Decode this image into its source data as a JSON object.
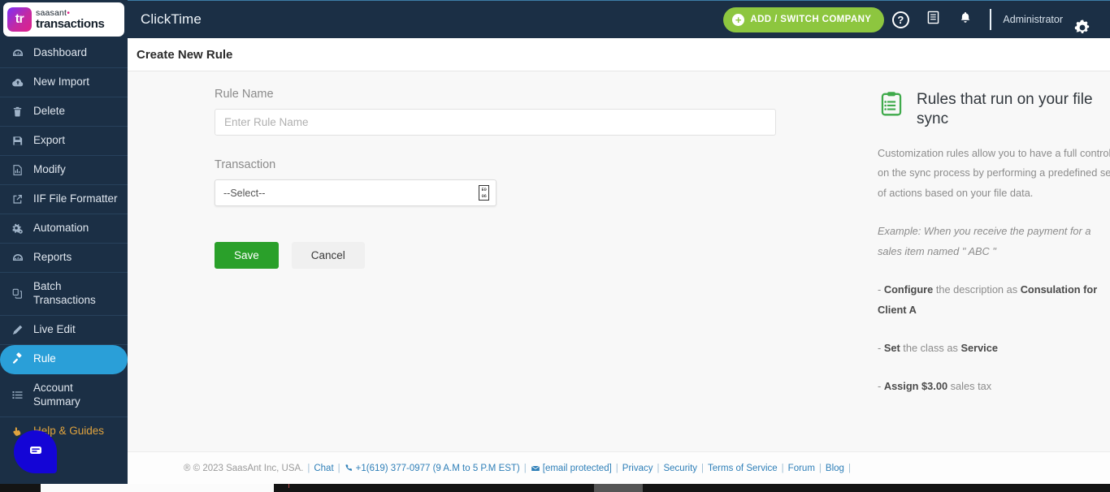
{
  "brand": {
    "logo_mark": "tr",
    "logo_top": "saasant",
    "logo_bottom": "transactions"
  },
  "header": {
    "company_title": "ClickTime",
    "switch_company_label": "ADD / SWITCH COMPANY",
    "help_icon": "question-circle-icon",
    "list_icon": "list-document-icon",
    "bell_icon": "notification-bell-icon",
    "user_label": "Administrator",
    "gear_icon": "gear-icon",
    "accent_green": "#8dc63f",
    "bar_color": "#1b2f45"
  },
  "sidebar": {
    "active_color": "#2a9fd8",
    "help_color": "#e0a33e",
    "items": [
      {
        "label": "Dashboard",
        "icon": "dashboard-icon",
        "active": false
      },
      {
        "label": "New Import",
        "icon": "cloud-upload-icon",
        "active": false
      },
      {
        "label": "Delete",
        "icon": "trash-icon",
        "active": false
      },
      {
        "label": "Export",
        "icon": "save-disk-icon",
        "active": false
      },
      {
        "label": "Modify",
        "icon": "file-chart-icon",
        "active": false
      },
      {
        "label": "IIF File Formatter",
        "icon": "external-link-icon",
        "active": false
      },
      {
        "label": "Automation",
        "icon": "gears-icon",
        "active": false
      },
      {
        "label": "Reports",
        "icon": "reports-gauge-icon",
        "active": false
      },
      {
        "label": "Batch Transactions",
        "icon": "copy-files-icon",
        "active": false
      },
      {
        "label": "Live Edit",
        "icon": "pencil-icon",
        "active": false
      },
      {
        "label": "Rule",
        "icon": "gavel-icon",
        "active": true
      },
      {
        "label": "Account Summary",
        "icon": "list-bullet-icon",
        "active": false
      },
      {
        "label": "Help & Guides",
        "icon": "hand-pointer-icon",
        "active": false
      }
    ],
    "chat_widget_icon": "chat-bubble-icon"
  },
  "page": {
    "title": "Create New Rule"
  },
  "form": {
    "rule_name_label": "Rule Name",
    "rule_name_value": "",
    "rule_name_placeholder": "Enter Rule Name",
    "transaction_label": "Transaction",
    "transaction_value": "--Select--",
    "transaction_glyph_top": "E0",
    "transaction_glyph_bottom": "06",
    "save_label": "Save",
    "cancel_label": "Cancel",
    "save_color": "#2aa02a"
  },
  "info_panel": {
    "icon": "clipboard-list-icon",
    "icon_color": "#3faa4b",
    "title": "Rules that run on your file sync",
    "body": "Customization rules allow you to have a full control on the sync process by performing a predefined set of actions based on your file data.",
    "example": "Example: When you receive the payment for a sales item named \" ABC \"",
    "bullets": [
      {
        "dash": "- ",
        "bold1": "Configure",
        "mid": " the description as ",
        "bold2": "Consulation for Client A",
        "tail": ""
      },
      {
        "dash": "- ",
        "bold1": "Set",
        "mid": " the class as ",
        "bold2": "Service",
        "tail": ""
      },
      {
        "dash": "- ",
        "bold1": "Assign $3.00",
        "mid": " sales tax",
        "bold2": "",
        "tail": ""
      }
    ]
  },
  "footer": {
    "copyright": "® © 2023 SaasAnt Inc, USA.",
    "chat_label": "Chat",
    "phone": "+1(619) 377-0977 (9 A.M to 5 P.M EST)",
    "email_label": "[email protected]",
    "privacy_label": "Privacy",
    "security_label": "Security",
    "terms_label": "Terms of Service",
    "forum_label": "Forum",
    "blog_label": "Blog"
  }
}
